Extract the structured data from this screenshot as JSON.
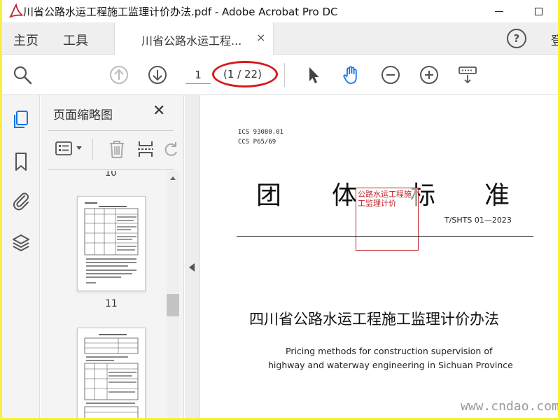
{
  "window": {
    "title": "川省公路水运工程施工监理计价办法.pdf - Adobe Acrobat Pro DC"
  },
  "tabs": {
    "home": "主页",
    "tools": "工具",
    "document": "川省公路水运工程...",
    "close": "×",
    "help": "?",
    "signin": "登"
  },
  "toolbar": {
    "page_number": "1",
    "page_count": "(1 / 22)"
  },
  "thumbnails": {
    "title": "页面缩略图",
    "close": "✕",
    "pages": [
      {
        "label": "10"
      },
      {
        "label": "11"
      }
    ]
  },
  "document": {
    "ics": "ICS 93080.01",
    "ccs": "CCS P65/69",
    "header_chars": [
      "团",
      "体",
      "标",
      "准"
    ],
    "standard_no": "T/SHTS 01—2023",
    "stamp_text": "公路水运工程施工监理计价",
    "title_cn": "四川省公路水运工程施工监理计价办法",
    "title_en_1": "Pricing methods for construction supervision of",
    "title_en_2": "highway and waterway engineering in Sichuan Province"
  },
  "watermark": "www.cndao.com",
  "colors": {
    "accent_blue": "#1473e6",
    "highlight_red": "#d7191e",
    "outer_border": "#f9f03b"
  }
}
